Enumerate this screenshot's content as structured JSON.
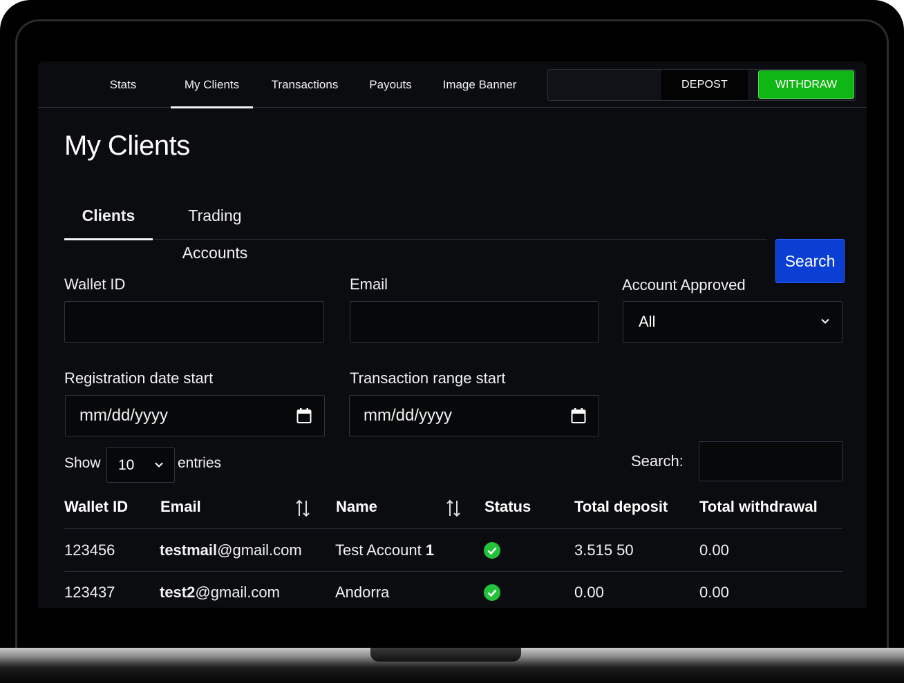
{
  "nav": {
    "items": [
      {
        "label": "Stats"
      },
      {
        "label": "My Clients"
      },
      {
        "label": "Transactions"
      },
      {
        "label": "Payouts"
      },
      {
        "label": "Image Banner"
      }
    ],
    "active": "My Clients",
    "deposit_label": "DEPOST",
    "withdraw_label": "WITHDRAW"
  },
  "page": {
    "title": "My Clients"
  },
  "tabs": [
    {
      "label": "Clients",
      "active": true
    },
    {
      "label": "Trading Accounts",
      "active": false
    }
  ],
  "filters": {
    "wallet_id": {
      "label": "Wallet ID",
      "value": ""
    },
    "email": {
      "label": "Email",
      "value": ""
    },
    "account_approved": {
      "label": "Account Approved",
      "value": "All"
    },
    "registration_date_start": {
      "label": "Registration date start",
      "placeholder": "mm/dd/yyyy"
    },
    "transaction_range_start": {
      "label": "Transaction range start",
      "placeholder": "mm/dd/yyyy"
    },
    "search_button": "Search"
  },
  "table_controls": {
    "show_label": "Show",
    "entries_value": "10",
    "entries_label": "entries",
    "search_label": "Search:",
    "search_value": ""
  },
  "table": {
    "columns": [
      "Wallet ID",
      "Email",
      "Name",
      "Status",
      "Total deposit",
      "Total withdrawal"
    ],
    "rows": [
      {
        "wallet_id": "123456",
        "email_user": "testmail",
        "email_domain": "@gmail.com",
        "name_text": "Test Account ",
        "name_num": "1",
        "status": "approved",
        "total_deposit": "3.515 50",
        "total_withdrawal": "0.00"
      },
      {
        "wallet_id": "123437",
        "email_user": "test2",
        "email_domain": "@gmail.com",
        "name_text": "Andorra",
        "name_num": "",
        "status": "approved",
        "total_deposit": "0.00",
        "total_withdrawal": "0.00"
      }
    ]
  },
  "colors": {
    "background": "#0b0c0f",
    "withdraw": "#10b614",
    "search": "#0b3fd4",
    "status_ok": "#22c33a"
  },
  "icons": {
    "calendar": "calendar-icon",
    "chevron": "chevron-down-icon",
    "sort": "sort-icon",
    "status": "check-circle-icon"
  }
}
